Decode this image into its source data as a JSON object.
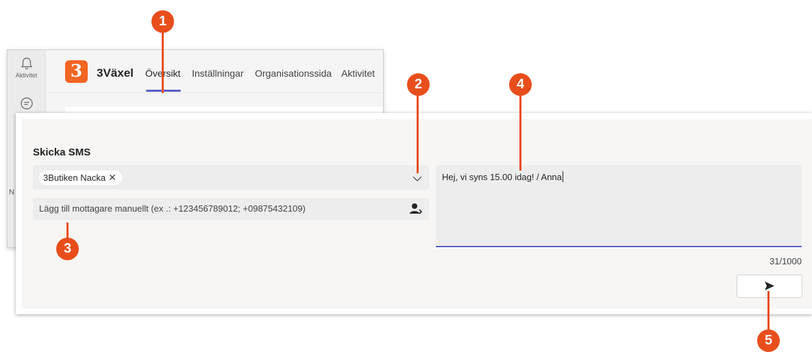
{
  "sidebar": {
    "items": [
      {
        "label": "Aktivitet",
        "icon": "bell-icon"
      },
      {
        "label": "",
        "icon": "chat-icon"
      }
    ],
    "partial_letter": "N"
  },
  "app": {
    "logo_glyph": "3",
    "name": "3Växel",
    "tabs": [
      {
        "label": "Översikt",
        "active": true
      },
      {
        "label": "Inställningar",
        "active": false
      },
      {
        "label": "Organisationssida",
        "active": false
      },
      {
        "label": "Aktivitet",
        "active": false
      }
    ]
  },
  "sms": {
    "title": "Skicka SMS",
    "recipient_chip": "3Butiken Nacka",
    "chip_remove_glyph": "✕",
    "manual_placeholder": "Lägg till mottagare manuellt (ex .: +123456789012; +09875432109)",
    "message": "Hej, vi syns 15.00 idag! / Anna",
    "counter": "31/1000",
    "send_icon": "send-arrow-icon"
  },
  "callouts": [
    "1",
    "2",
    "3",
    "4",
    "5"
  ],
  "colors": {
    "accent": "#5b5fc7",
    "callout": "#e84e1b",
    "brand": "#f26522"
  }
}
